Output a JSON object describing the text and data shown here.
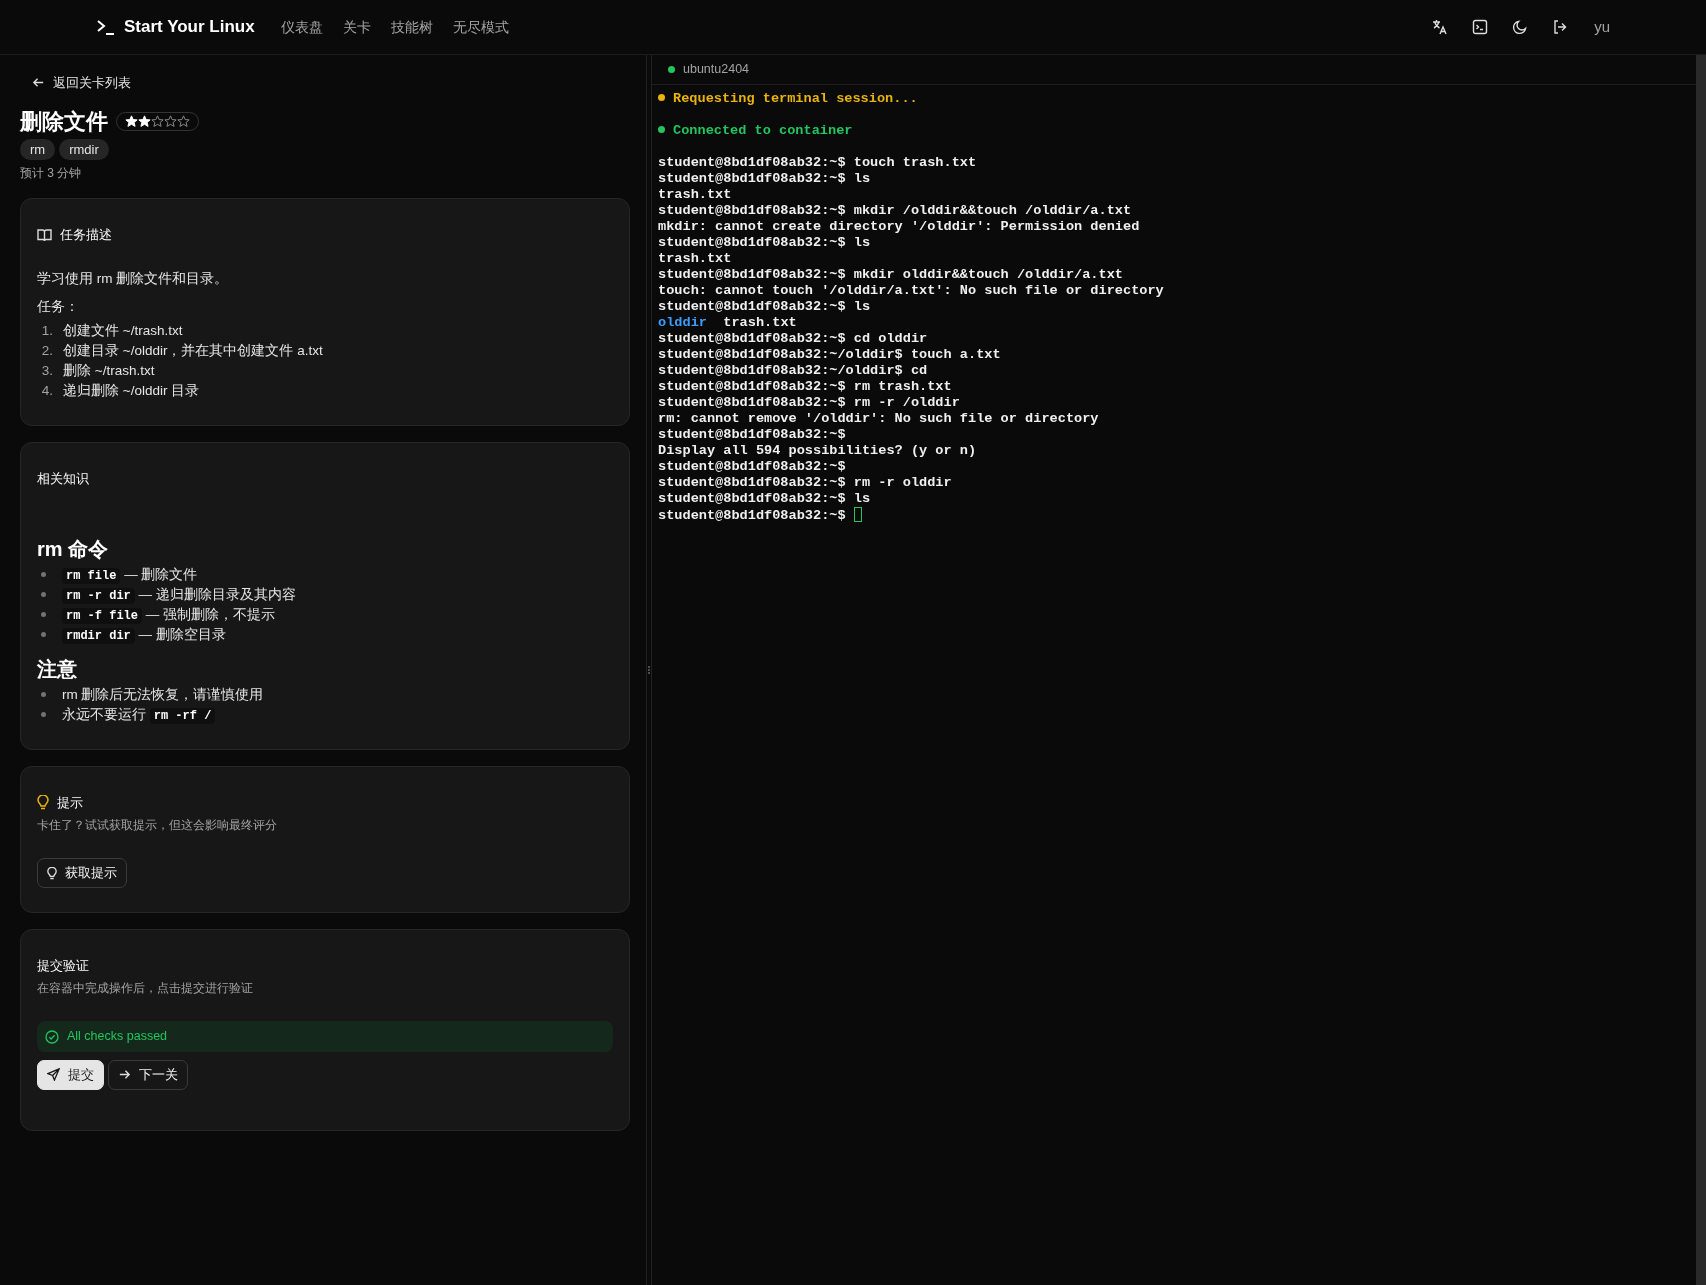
{
  "header": {
    "logo_text": "Start Your Linux",
    "nav": [
      {
        "label": "仪表盘"
      },
      {
        "label": "关卡"
      },
      {
        "label": "技能树"
      },
      {
        "label": "无尽模式"
      }
    ],
    "user": "yu"
  },
  "back_link": "返回关卡列表",
  "level": {
    "title": "删除文件",
    "stars": 2,
    "tags": [
      "rm",
      "rmdir"
    ],
    "estimate": "预计 3 分钟"
  },
  "task_card": {
    "title": "任务描述",
    "intro": "学习使用 rm 删除文件和目录。",
    "tasks_label": "任务：",
    "tasks": [
      {
        "number": "1.",
        "text": "创建文件 ~/trash.txt"
      },
      {
        "number": "2.",
        "text": "创建目录 ~/olddir，并在其中创建文件 a.txt"
      },
      {
        "number": "3.",
        "text": "删除 ~/trash.txt"
      },
      {
        "number": "4.",
        "text": "递归删除 ~/olddir 目录"
      }
    ]
  },
  "knowledge_card": {
    "title": "相关知识",
    "sections": [
      {
        "heading": "rm 命令",
        "items": [
          {
            "parts": [
              {
                "kind": "code",
                "text": "rm file"
              },
              {
                "kind": "text",
                "text": "— 删除文件"
              }
            ]
          },
          {
            "parts": [
              {
                "kind": "code",
                "text": "rm -r dir"
              },
              {
                "kind": "text",
                "text": "— 递归删除目录及其内容"
              }
            ]
          },
          {
            "parts": [
              {
                "kind": "code",
                "text": "rm -f file"
              },
              {
                "kind": "text",
                "text": "— 强制删除，不提示"
              }
            ]
          },
          {
            "parts": [
              {
                "kind": "code",
                "text": "rmdir dir"
              },
              {
                "kind": "text",
                "text": "— 删除空目录"
              }
            ]
          }
        ]
      },
      {
        "heading": "注意",
        "items": [
          {
            "parts": [
              {
                "kind": "text",
                "text": "rm 删除后无法恢复，请谨慎使用"
              }
            ]
          },
          {
            "parts": [
              {
                "kind": "text",
                "text": "永远不要运行"
              },
              {
                "kind": "code",
                "text": "rm -rf /"
              }
            ]
          }
        ]
      }
    ]
  },
  "hint_card": {
    "title": "提示",
    "description": "卡住了？试试获取提示，但这会影响最终评分",
    "button": "获取提示"
  },
  "submit_card": {
    "title": "提交验证",
    "description": "在容器中完成操作后，点击提交进行验证",
    "result": {
      "passed": true,
      "text": "All checks passed"
    },
    "buttons": [
      {
        "label": "提交",
        "kind": "primary"
      },
      {
        "label": "下一关",
        "kind": "secondary"
      }
    ]
  },
  "terminal": {
    "host": "ubuntu2404",
    "connected": true,
    "lines": [
      {
        "kind": "status",
        "color": "#eab308",
        "text": "Requesting terminal session..."
      },
      {
        "kind": "status",
        "color": "#22c55e",
        "text": "Connected to container"
      },
      {
        "kind": "output",
        "text": "student@8bd1df08ab32:~$ touch trash.txt"
      },
      {
        "kind": "output",
        "text": "student@8bd1df08ab32:~$ ls"
      },
      {
        "kind": "output",
        "text": "trash.txt"
      },
      {
        "kind": "output",
        "text": "student@8bd1df08ab32:~$ mkdir /olddir&&touch /olddir/a.txt"
      },
      {
        "kind": "output",
        "text": "mkdir: cannot create directory '/olddir': Permission denied"
      },
      {
        "kind": "output",
        "text": "student@8bd1df08ab32:~$ ls"
      },
      {
        "kind": "output",
        "text": "trash.txt"
      },
      {
        "kind": "output",
        "text": "student@8bd1df08ab32:~$ mkdir olddir&&touch /olddir/a.txt"
      },
      {
        "kind": "output",
        "text": "touch: cannot touch '/olddir/a.txt': No such file or directory"
      },
      {
        "kind": "output",
        "text": "student@8bd1df08ab32:~$ ls"
      },
      {
        "kind": "listing",
        "entries": [
          {
            "text": "olddir",
            "kind": "directory"
          },
          {
            "text": "trash.txt",
            "kind": "file"
          }
        ]
      },
      {
        "kind": "output",
        "text": "student@8bd1df08ab32:~$ cd olddir"
      },
      {
        "kind": "output",
        "text": "student@8bd1df08ab32:~/olddir$ touch a.txt"
      },
      {
        "kind": "output",
        "text": "student@8bd1df08ab32:~/olddir$ cd"
      },
      {
        "kind": "output",
        "text": "student@8bd1df08ab32:~$ rm trash.txt"
      },
      {
        "kind": "output",
        "text": "student@8bd1df08ab32:~$ rm -r /olddir"
      },
      {
        "kind": "output",
        "text": "rm: cannot remove '/olddir': No such file or directory"
      },
      {
        "kind": "output",
        "text": "student@8bd1df08ab32:~$"
      },
      {
        "kind": "output",
        "text": "Display all 594 possibilities? (y or n)"
      },
      {
        "kind": "output",
        "text": "student@8bd1df08ab32:~$"
      },
      {
        "kind": "output",
        "text": "student@8bd1df08ab32:~$ rm -r olddir"
      },
      {
        "kind": "output",
        "text": "student@8bd1df08ab32:~$ ls"
      },
      {
        "kind": "output",
        "text": "student@8bd1df08ab32:~$",
        "cursor": true
      }
    ]
  }
}
